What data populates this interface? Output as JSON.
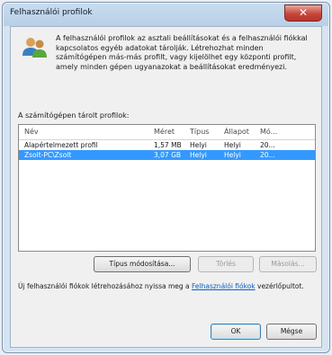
{
  "window": {
    "title": "Felhasználói profilok",
    "close_glyph": "✕"
  },
  "info": {
    "icon": "users-icon",
    "text": "A felhasználói profilok az asztali beállításokat és a felhasználói fiókkal kapcsolatos egyéb adatokat tárolják. Létrehozhat minden számítógépen más-más profilt, vagy kijelölhet egy központi profilt, amely minden gépen ugyanazokat a beállításokat eredményezi."
  },
  "profiles": {
    "label": "A számítógépen tárolt profilok:",
    "columns": [
      "Név",
      "Méret",
      "Típus",
      "Állapot",
      "Mó..."
    ],
    "rows": [
      {
        "name": "Alapértelmezett profil",
        "size": "1,57 MB",
        "type": "Helyi",
        "status": "Helyi",
        "modified": "20...",
        "selected": false
      },
      {
        "name": "Zsolt-PC\\Zsolt",
        "size": "3,07 GB",
        "type": "Helyi",
        "status": "Helyi",
        "modified": "20...",
        "selected": true
      }
    ]
  },
  "buttons": {
    "change_type": "Típus módosítása...",
    "delete": "Törlés",
    "copy": "Másolás...",
    "ok": "OK",
    "cancel": "Mégse"
  },
  "footer": {
    "text_before": "Új felhasználói fiókok létrehozásához nyissa meg a ",
    "link": "Felhasználói fiókok",
    "text_after": " vezérlőpultot."
  },
  "colors": {
    "selection": "#3399ff",
    "link": "#0a5fc4",
    "close_button": "#c8463a"
  }
}
